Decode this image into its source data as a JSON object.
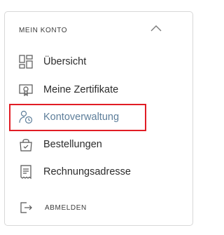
{
  "menu": {
    "title": "MEIN KONTO",
    "items": [
      {
        "label": "Übersicht",
        "icon": "dashboard-grid-icon"
      },
      {
        "label": "Meine Zertifikate",
        "icon": "certificate-icon"
      },
      {
        "label": "Kontoverwaltung",
        "icon": "user-settings-icon",
        "active": true
      },
      {
        "label": "Bestellungen",
        "icon": "shopping-bag-icon"
      },
      {
        "label": "Rechnungsadresse",
        "icon": "receipt-icon"
      }
    ],
    "logout_label": "ABMELDEN"
  },
  "colors": {
    "active_text": "#5d7e9a",
    "highlight_border": "#e11d25",
    "panel_border": "#d8d8d8",
    "text": "#2c2c2c"
  }
}
